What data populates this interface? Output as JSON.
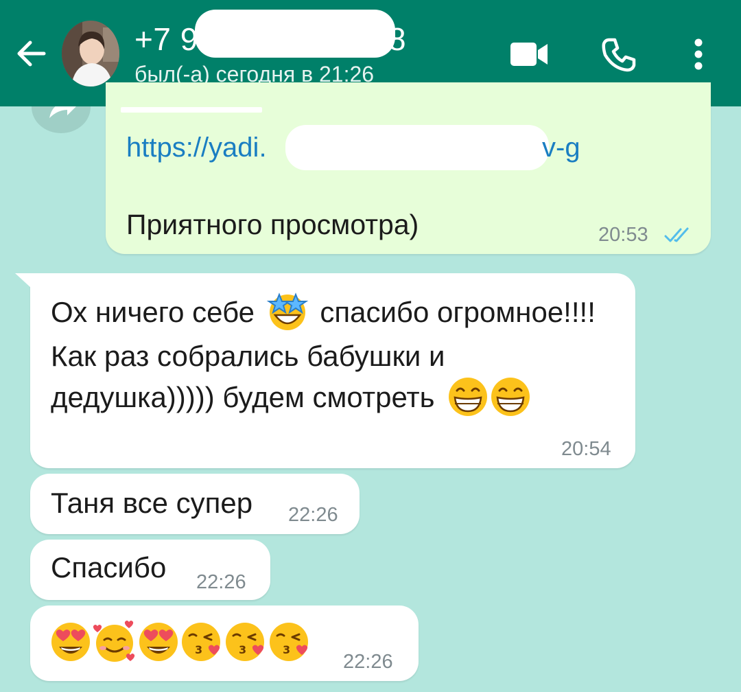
{
  "header": {
    "contact_name": "+7 9",
    "contact_name_tail": "8",
    "status": "был(-а) сегодня в 21:26",
    "icons": [
      "back-arrow-icon",
      "avatar",
      "video-call-icon",
      "phone-icon",
      "more-vert-icon"
    ]
  },
  "messages": [
    {
      "id": "m1",
      "direction": "out",
      "link_prefix": "https://yadi.",
      "link_suffix": "v-g",
      "text": "Приятного просмотра)",
      "time": "20:53",
      "read": true
    },
    {
      "id": "m2",
      "direction": "in",
      "line1_a": "Ох ничего себе",
      "line1_b": "спасибо огромное!!!!",
      "line2": "Как раз собрались бабушки и",
      "line3": "дедушка))))) будем смотреть",
      "time": "20:54"
    },
    {
      "id": "m3",
      "direction": "in",
      "text": "Таня все супер",
      "time": "22:26"
    },
    {
      "id": "m4",
      "direction": "in",
      "text": "Спасибо",
      "time": "22:26"
    },
    {
      "id": "m5",
      "direction": "in",
      "emojis": [
        "heart-eyes",
        "smiling-hearts",
        "heart-eyes",
        "kissing-heart",
        "kissing-heart",
        "kissing-heart"
      ],
      "time": "22:26"
    }
  ],
  "colors": {
    "header": "#008069",
    "chat_bg": "#b3e6dd",
    "outgoing": "#e7fed9",
    "incoming": "#ffffff",
    "link": "#1a7ec2",
    "read_ticks": "#53bdeb"
  }
}
